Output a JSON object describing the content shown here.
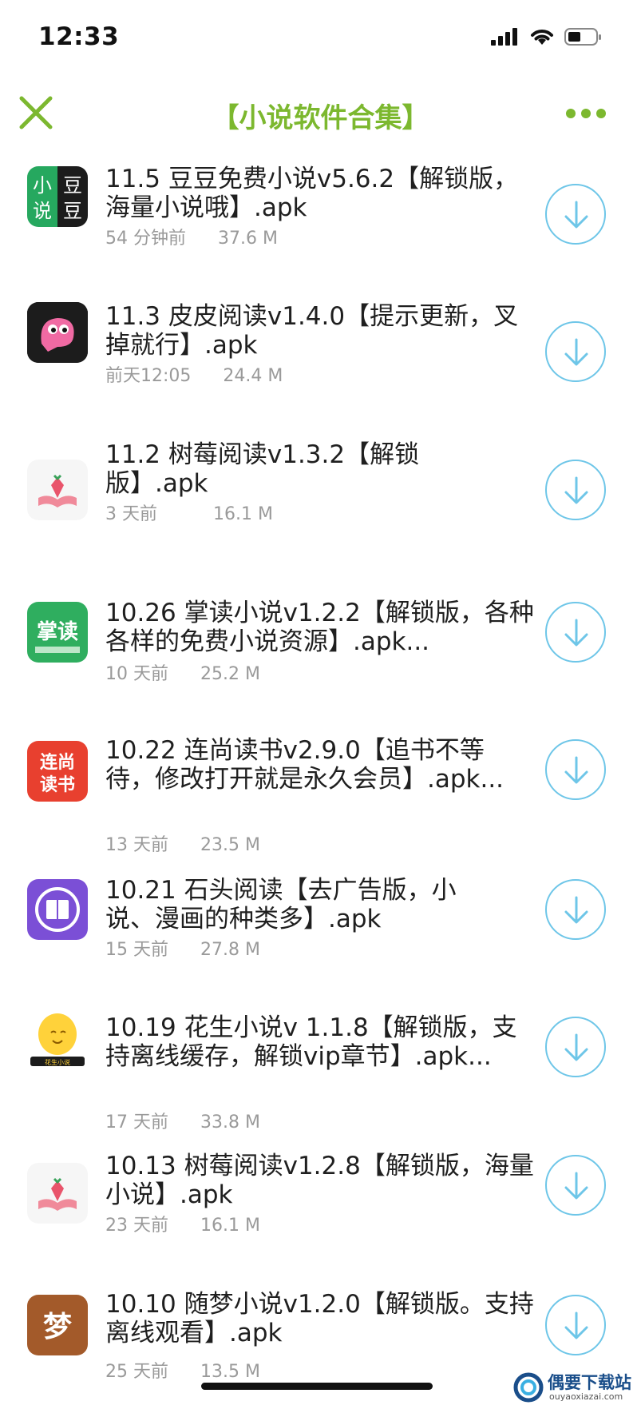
{
  "status_bar": {
    "time": "12:33"
  },
  "nav": {
    "title": "【小说软件合集】"
  },
  "files": [
    {
      "title": "11.5 豆豆免费小说v5.6.2【解锁版，海量小说哦】.apk",
      "time": "54 分钟前",
      "size": "37.6 M",
      "icon": "doudou-app-icon",
      "icon_text": [
        "小",
        "豆",
        "说",
        "豆"
      ]
    },
    {
      "title": "11.3 皮皮阅读v1.4.0【提示更新，叉掉就行】.apk",
      "time": "前天12:05",
      "size": "24.4 M",
      "icon": "pipi-app-icon"
    },
    {
      "title": "11.2 树莓阅读v1.3.2【解锁版】.apk",
      "time": "3 天前",
      "size": "16.1 M",
      "icon": "shumei-app-icon"
    },
    {
      "title": "10.26 掌读小说v1.2.2【解锁版，各种各样的免费小说资源】.apk...",
      "time": "10 天前",
      "size": "25.2 M",
      "icon": "zhangdu-app-icon",
      "icon_text": [
        "掌读"
      ]
    },
    {
      "title": "10.22 连尚读书v2.9.0【追书不等待，修改打开就是永久会员】.apk...",
      "time": "13 天前",
      "size": "23.5 M",
      "icon": "lianshang-app-icon",
      "icon_text": [
        "连尚",
        "读书"
      ]
    },
    {
      "title": "10.21 石头阅读【去广告版，小说、漫画的种类多】.apk",
      "time": "15 天前",
      "size": "27.8 M",
      "icon": "shitou-app-icon"
    },
    {
      "title": "10.19 花生小说v 1.1.8【解锁版，支持离线缓存，解锁vip章节】.apk...",
      "time": "17 天前",
      "size": "33.8 M",
      "icon": "huasheng-app-icon",
      "icon_text": [
        "花生小说"
      ]
    },
    {
      "title": "10.13 树莓阅读v1.2.8【解锁版，海量小说】.apk",
      "time": "23 天前",
      "size": "16.1 M",
      "icon": "shumei-app-icon"
    },
    {
      "title": "10.10 随梦小说v1.2.0【解锁版。支持离线观看】.apk",
      "time": "25 天前",
      "size": "13.5 M",
      "icon": "suimeng-app-icon",
      "icon_text": [
        "梦"
      ]
    }
  ],
  "watermark": {
    "name": "偶要下载站",
    "url": "ouyaoxiazai.com"
  },
  "colors": {
    "accent": "#7cb82f",
    "download_ring": "#6ec6e8",
    "meta_text": "#9a9a9a"
  }
}
